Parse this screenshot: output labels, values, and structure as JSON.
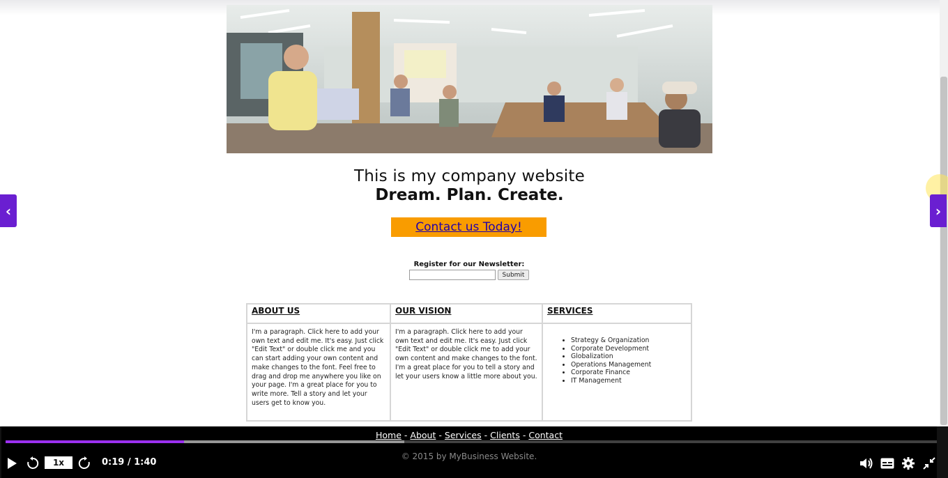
{
  "hero": {
    "image_icon": "office-meeting-photo"
  },
  "headline": {
    "line1": "This is my company website",
    "line2": "Dream. Plan. Create."
  },
  "cta": {
    "label": "Contact us Today!"
  },
  "newsletter": {
    "label": "Register for our Newsletter:",
    "input_value": "",
    "submit_label": "Submit"
  },
  "info_table": {
    "headers": [
      "ABOUT US",
      "OUR VISION",
      "SERVICES"
    ],
    "about_text": "I'm a paragraph. Click here to add your own text and edit me. It's easy. Just click \"Edit Text\" or double click me and you can start adding your own content and make changes to the font. Feel free to drag and drop me anywhere you like on your page. I'm a great place for you to write more. Tell a story and let your users get to know you.",
    "vision_text": "I'm a paragraph. Click here to add your own text and edit me. It's easy. Just click \"Edit Text\" or double click me to add your own content and make changes to the font. I'm a great place for you to tell a story and let your users know a little more about you.",
    "services": [
      "Strategy & Organization",
      "Corporate Development",
      "Globalization",
      "Operations Management",
      "Corporate Finance",
      "IT Management"
    ]
  },
  "footer": {
    "links": [
      "Home",
      "About",
      "Services",
      "Clients",
      "Contact"
    ],
    "separator": "-",
    "copyright": "© 2015 by MyBusiness Website."
  },
  "player": {
    "speed": "1x",
    "time": "0:19 / 1:40",
    "progress_fraction": 0.19,
    "buffered_fraction": 0.43,
    "accent_color": "#9b30f0",
    "icons": [
      "play-icon",
      "rewind-icon",
      "forward-icon",
      "volume-icon",
      "captions-icon",
      "settings-icon",
      "exit-fullscreen-icon"
    ]
  },
  "navigation": {
    "prev_icon": "chevron-left-icon",
    "next_icon": "chevron-right-icon",
    "color": "#6a1fd1"
  }
}
